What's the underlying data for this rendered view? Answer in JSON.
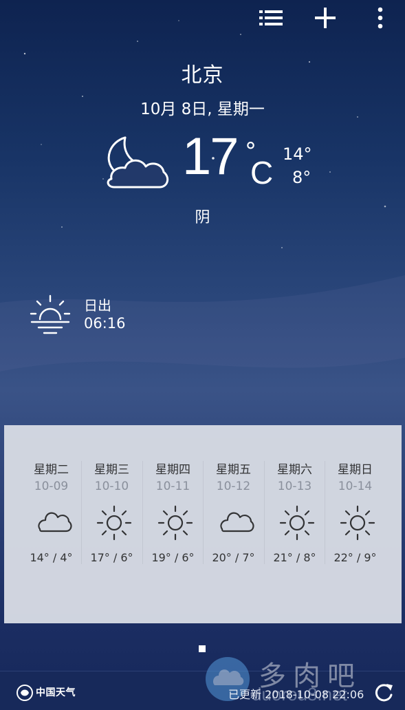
{
  "header": {
    "list_icon": "list-icon",
    "add_icon": "plus-icon",
    "menu_icon": "more-vert-icon"
  },
  "current": {
    "city": "北京",
    "date": "10月 8日, 星期一",
    "icon": "moon-cloud-icon",
    "temp": "17",
    "degree": "°",
    "unit": "C",
    "high": "14°",
    "low": "8°",
    "condition": "阴"
  },
  "sunrise": {
    "icon": "sunrise-icon",
    "label": "日出",
    "time": "06:16"
  },
  "forecast": [
    {
      "weekday": "星期二",
      "date": "10-09",
      "icon": "cloud-icon",
      "temps": "14° / 4°"
    },
    {
      "weekday": "星期三",
      "date": "10-10",
      "icon": "sun-icon",
      "temps": "17° / 6°"
    },
    {
      "weekday": "星期四",
      "date": "10-11",
      "icon": "sun-icon",
      "temps": "19° / 6°"
    },
    {
      "weekday": "星期五",
      "date": "10-12",
      "icon": "cloud-icon",
      "temps": "20° / 7°"
    },
    {
      "weekday": "星期六",
      "date": "10-13",
      "icon": "sun-icon",
      "temps": "21° / 8°"
    },
    {
      "weekday": "星期日",
      "date": "10-14",
      "icon": "sun-icon",
      "temps": "22° / 9°"
    }
  ],
  "footer": {
    "logo_text": "中国天气",
    "updated": "已更新 2018-10-08 22:06",
    "refresh_icon": "refresh-icon"
  },
  "watermark": {
    "text": "多肉吧",
    "sub": "duorou8.net"
  }
}
